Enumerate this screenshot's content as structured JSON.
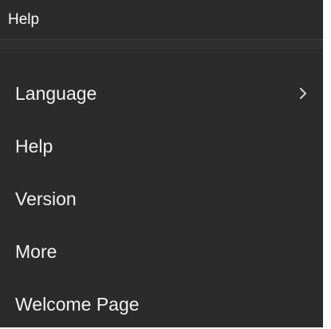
{
  "menubar": {
    "title": "Help"
  },
  "dropdown": {
    "items": [
      {
        "label": "Language",
        "has_submenu": true,
        "submenu_icon": "chevron-right-icon"
      },
      {
        "label": "Help",
        "has_submenu": false
      },
      {
        "label": "Version",
        "has_submenu": false
      },
      {
        "label": "More",
        "has_submenu": false
      },
      {
        "label": "Welcome Page",
        "has_submenu": false
      }
    ]
  },
  "colors": {
    "menu_background": "#2b2b2b",
    "menu_text": "#f2f2f2",
    "separator": "#3d3d3d"
  }
}
